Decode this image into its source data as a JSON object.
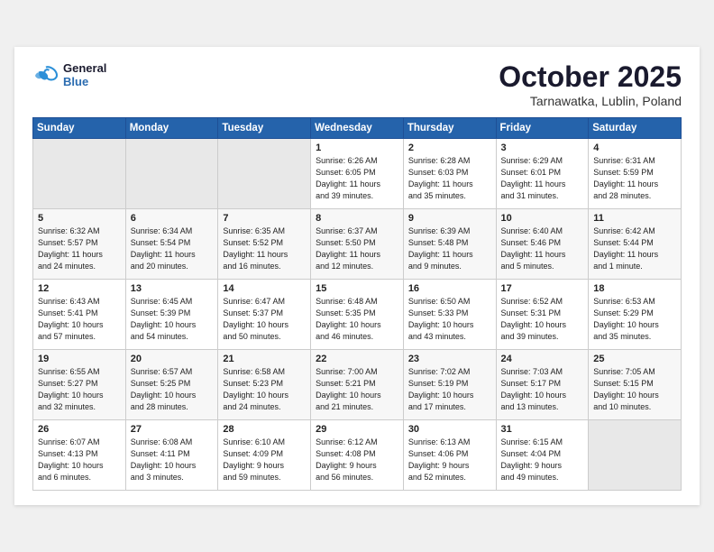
{
  "header": {
    "logo_general": "General",
    "logo_blue": "Blue",
    "month": "October 2025",
    "location": "Tarnawatka, Lublin, Poland"
  },
  "weekdays": [
    "Sunday",
    "Monday",
    "Tuesday",
    "Wednesday",
    "Thursday",
    "Friday",
    "Saturday"
  ],
  "weeks": [
    [
      {
        "day": "",
        "info": ""
      },
      {
        "day": "",
        "info": ""
      },
      {
        "day": "",
        "info": ""
      },
      {
        "day": "1",
        "info": "Sunrise: 6:26 AM\nSunset: 6:05 PM\nDaylight: 11 hours\nand 39 minutes."
      },
      {
        "day": "2",
        "info": "Sunrise: 6:28 AM\nSunset: 6:03 PM\nDaylight: 11 hours\nand 35 minutes."
      },
      {
        "day": "3",
        "info": "Sunrise: 6:29 AM\nSunset: 6:01 PM\nDaylight: 11 hours\nand 31 minutes."
      },
      {
        "day": "4",
        "info": "Sunrise: 6:31 AM\nSunset: 5:59 PM\nDaylight: 11 hours\nand 28 minutes."
      }
    ],
    [
      {
        "day": "5",
        "info": "Sunrise: 6:32 AM\nSunset: 5:57 PM\nDaylight: 11 hours\nand 24 minutes."
      },
      {
        "day": "6",
        "info": "Sunrise: 6:34 AM\nSunset: 5:54 PM\nDaylight: 11 hours\nand 20 minutes."
      },
      {
        "day": "7",
        "info": "Sunrise: 6:35 AM\nSunset: 5:52 PM\nDaylight: 11 hours\nand 16 minutes."
      },
      {
        "day": "8",
        "info": "Sunrise: 6:37 AM\nSunset: 5:50 PM\nDaylight: 11 hours\nand 12 minutes."
      },
      {
        "day": "9",
        "info": "Sunrise: 6:39 AM\nSunset: 5:48 PM\nDaylight: 11 hours\nand 9 minutes."
      },
      {
        "day": "10",
        "info": "Sunrise: 6:40 AM\nSunset: 5:46 PM\nDaylight: 11 hours\nand 5 minutes."
      },
      {
        "day": "11",
        "info": "Sunrise: 6:42 AM\nSunset: 5:44 PM\nDaylight: 11 hours\nand 1 minute."
      }
    ],
    [
      {
        "day": "12",
        "info": "Sunrise: 6:43 AM\nSunset: 5:41 PM\nDaylight: 10 hours\nand 57 minutes."
      },
      {
        "day": "13",
        "info": "Sunrise: 6:45 AM\nSunset: 5:39 PM\nDaylight: 10 hours\nand 54 minutes."
      },
      {
        "day": "14",
        "info": "Sunrise: 6:47 AM\nSunset: 5:37 PM\nDaylight: 10 hours\nand 50 minutes."
      },
      {
        "day": "15",
        "info": "Sunrise: 6:48 AM\nSunset: 5:35 PM\nDaylight: 10 hours\nand 46 minutes."
      },
      {
        "day": "16",
        "info": "Sunrise: 6:50 AM\nSunset: 5:33 PM\nDaylight: 10 hours\nand 43 minutes."
      },
      {
        "day": "17",
        "info": "Sunrise: 6:52 AM\nSunset: 5:31 PM\nDaylight: 10 hours\nand 39 minutes."
      },
      {
        "day": "18",
        "info": "Sunrise: 6:53 AM\nSunset: 5:29 PM\nDaylight: 10 hours\nand 35 minutes."
      }
    ],
    [
      {
        "day": "19",
        "info": "Sunrise: 6:55 AM\nSunset: 5:27 PM\nDaylight: 10 hours\nand 32 minutes."
      },
      {
        "day": "20",
        "info": "Sunrise: 6:57 AM\nSunset: 5:25 PM\nDaylight: 10 hours\nand 28 minutes."
      },
      {
        "day": "21",
        "info": "Sunrise: 6:58 AM\nSunset: 5:23 PM\nDaylight: 10 hours\nand 24 minutes."
      },
      {
        "day": "22",
        "info": "Sunrise: 7:00 AM\nSunset: 5:21 PM\nDaylight: 10 hours\nand 21 minutes."
      },
      {
        "day": "23",
        "info": "Sunrise: 7:02 AM\nSunset: 5:19 PM\nDaylight: 10 hours\nand 17 minutes."
      },
      {
        "day": "24",
        "info": "Sunrise: 7:03 AM\nSunset: 5:17 PM\nDaylight: 10 hours\nand 13 minutes."
      },
      {
        "day": "25",
        "info": "Sunrise: 7:05 AM\nSunset: 5:15 PM\nDaylight: 10 hours\nand 10 minutes."
      }
    ],
    [
      {
        "day": "26",
        "info": "Sunrise: 6:07 AM\nSunset: 4:13 PM\nDaylight: 10 hours\nand 6 minutes."
      },
      {
        "day": "27",
        "info": "Sunrise: 6:08 AM\nSunset: 4:11 PM\nDaylight: 10 hours\nand 3 minutes."
      },
      {
        "day": "28",
        "info": "Sunrise: 6:10 AM\nSunset: 4:09 PM\nDaylight: 9 hours\nand 59 minutes."
      },
      {
        "day": "29",
        "info": "Sunrise: 6:12 AM\nSunset: 4:08 PM\nDaylight: 9 hours\nand 56 minutes."
      },
      {
        "day": "30",
        "info": "Sunrise: 6:13 AM\nSunset: 4:06 PM\nDaylight: 9 hours\nand 52 minutes."
      },
      {
        "day": "31",
        "info": "Sunrise: 6:15 AM\nSunset: 4:04 PM\nDaylight: 9 hours\nand 49 minutes."
      },
      {
        "day": "",
        "info": ""
      }
    ]
  ]
}
